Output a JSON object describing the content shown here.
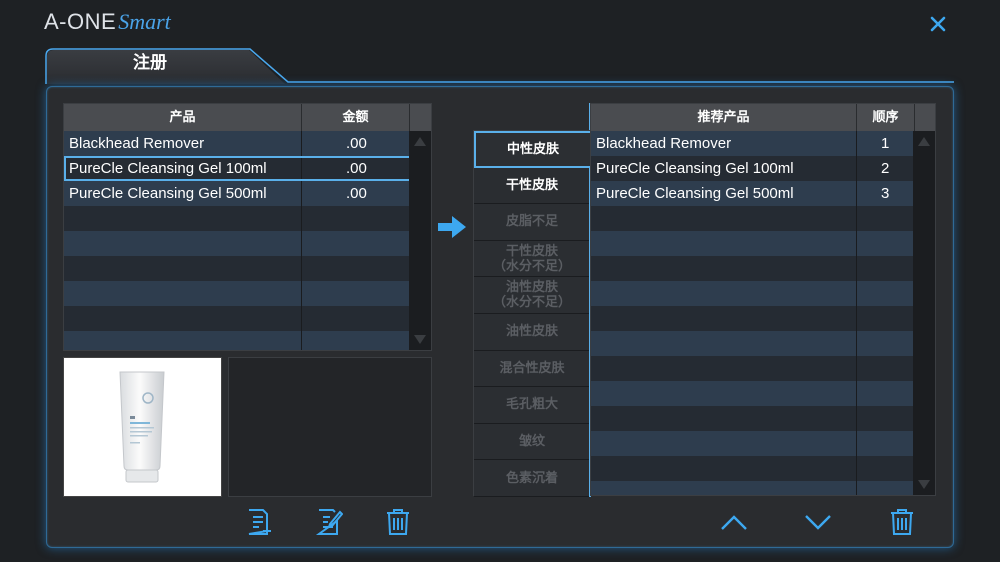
{
  "app": {
    "logo_main": "A-ONE",
    "logo_sub": "Smart",
    "close_label": "×"
  },
  "tab": {
    "title": "注册"
  },
  "products": {
    "headers": [
      "产品",
      "金额"
    ],
    "rows": [
      {
        "name": "Blackhead Remover",
        "amount": ".00"
      },
      {
        "name": "PureCle Cleansing Gel 100ml",
        "amount": ".00"
      },
      {
        "name": "PureCle Cleansing Gel 500ml",
        "amount": ".00"
      }
    ],
    "selected_index": 1
  },
  "skin_types": [
    {
      "label": "中性皮肤",
      "state": "current"
    },
    {
      "label": "干性皮肤",
      "state": "active"
    },
    {
      "label": "皮脂不足",
      "state": "disabled"
    },
    {
      "label": "干性皮肤\n（水分不足）",
      "state": "disabled"
    },
    {
      "label": "油性皮肤\n（水分不足）",
      "state": "disabled"
    },
    {
      "label": "油性皮肤",
      "state": "disabled"
    },
    {
      "label": "混合性皮肤",
      "state": "disabled"
    },
    {
      "label": "毛孔粗大",
      "state": "disabled"
    },
    {
      "label": "皱纹",
      "state": "disabled"
    },
    {
      "label": "色素沉着",
      "state": "disabled"
    }
  ],
  "recommended": {
    "headers": [
      "推荐产品",
      "顺序"
    ],
    "rows": [
      {
        "name": "Blackhead Remover",
        "order": "1"
      },
      {
        "name": "PureCle Cleansing Gel 100ml",
        "order": "2"
      },
      {
        "name": "PureCle Cleansing Gel 500ml",
        "order": "3"
      }
    ]
  },
  "colors": {
    "accent": "#3da8f0",
    "panel_bg": "#2a2c2f",
    "row_odd": "#2e3d4e",
    "row_even": "#252b33"
  },
  "icons": {
    "add": "add-document-icon",
    "edit": "edit-document-icon",
    "delete": "trash-icon",
    "up": "chevron-up-icon",
    "down": "chevron-down-icon",
    "transfer": "arrow-right-icon",
    "close": "close-icon"
  }
}
